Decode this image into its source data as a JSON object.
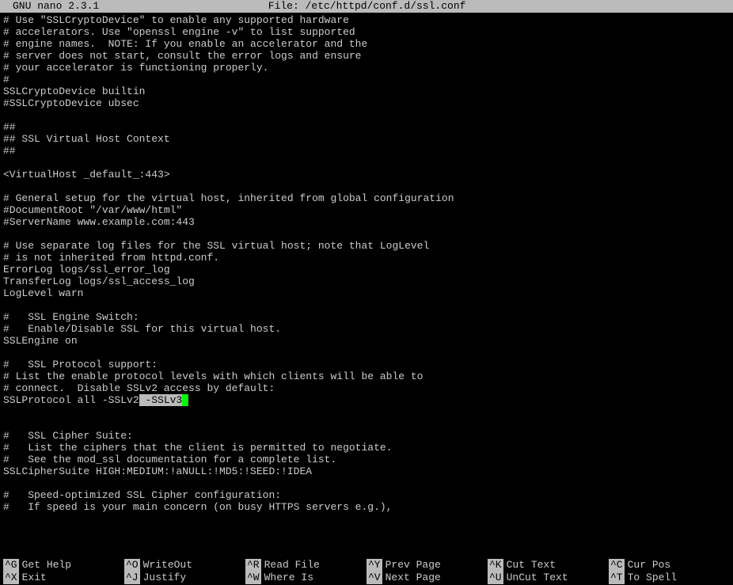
{
  "header": {
    "app": "GNU nano 2.3.1",
    "file_label": "File: /etc/httpd/conf.d/ssl.conf"
  },
  "lines": [
    "# Use \"SSLCryptoDevice\" to enable any supported hardware",
    "# accelerators. Use \"openssl engine -v\" to list supported",
    "# engine names.  NOTE: If you enable an accelerator and the",
    "# server does not start, consult the error logs and ensure",
    "# your accelerator is functioning properly.",
    "#",
    "SSLCryptoDevice builtin",
    "#SSLCryptoDevice ubsec",
    "",
    "##",
    "## SSL Virtual Host Context",
    "##",
    "",
    "<VirtualHost _default_:443>",
    "",
    "# General setup for the virtual host, inherited from global configuration",
    "#DocumentRoot \"/var/www/html\"",
    "#ServerName www.example.com:443",
    "",
    "# Use separate log files for the SSL virtual host; note that LogLevel",
    "# is not inherited from httpd.conf.",
    "ErrorLog logs/ssl_error_log",
    "TransferLog logs/ssl_access_log",
    "LogLevel warn",
    "",
    "#   SSL Engine Switch:",
    "#   Enable/Disable SSL for this virtual host.",
    "SSLEngine on",
    "",
    "#   SSL Protocol support:",
    "# List the enable protocol levels with which clients will be able to",
    "# connect.  Disable SSLv2 access by default:",
    "",
    "",
    "#   SSL Cipher Suite:",
    "#   List the ciphers that the client is permitted to negotiate.",
    "#   See the mod_ssl documentation for a complete list.",
    "SSLCipherSuite HIGH:MEDIUM:!aNULL:!MD5:!SEED:!IDEA",
    "",
    "#   Speed-optimized SSL Cipher configuration:",
    "#   If speed is your main concern (on busy HTTPS servers e.g.),"
  ],
  "special_line": {
    "prefix": "SSLProtocol all -SSLv2",
    "highlight": " -SSLv3"
  },
  "footer": {
    "row1": [
      {
        "key": "^G",
        "label": "Get Help"
      },
      {
        "key": "^O",
        "label": "WriteOut"
      },
      {
        "key": "^R",
        "label": "Read File"
      },
      {
        "key": "^Y",
        "label": "Prev Page"
      },
      {
        "key": "^K",
        "label": "Cut Text"
      },
      {
        "key": "^C",
        "label": "Cur Pos"
      }
    ],
    "row2": [
      {
        "key": "^X",
        "label": "Exit"
      },
      {
        "key": "^J",
        "label": "Justify"
      },
      {
        "key": "^W",
        "label": "Where Is"
      },
      {
        "key": "^V",
        "label": "Next Page"
      },
      {
        "key": "^U",
        "label": "UnCut Text"
      },
      {
        "key": "^T",
        "label": "To Spell"
      }
    ]
  }
}
